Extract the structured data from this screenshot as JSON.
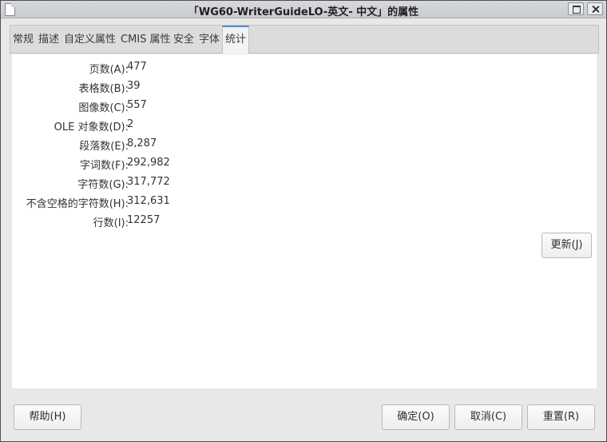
{
  "window": {
    "title": "「WG60-WriterGuideLO-英文- 中文」的属性"
  },
  "tabs": [
    {
      "label": "常规"
    },
    {
      "label": "描述"
    },
    {
      "label": "自定义属性"
    },
    {
      "label": "CMIS 属性"
    },
    {
      "label": "安全"
    },
    {
      "label": "字体"
    },
    {
      "label": "统计"
    }
  ],
  "active_tab": "统计",
  "statistics": [
    {
      "label": "页数(A):",
      "value": "477"
    },
    {
      "label": "表格数(B):",
      "value": "39"
    },
    {
      "label": "图像数(C):",
      "value": "557"
    },
    {
      "label": "OLE 对象数(D):",
      "value": "2"
    },
    {
      "label": "段落数(E):",
      "value": "8,287"
    },
    {
      "label": "字词数(F):",
      "value": "292,982"
    },
    {
      "label": "字符数(G):",
      "value": "317,772"
    },
    {
      "label": "不含空格的字符数(H):",
      "value": "312,631"
    },
    {
      "label": "行数(I):",
      "value": "12257"
    }
  ],
  "buttons": {
    "update": "更新(J)",
    "help": "帮助(H)",
    "ok": "确定(O)",
    "cancel": "取消(C)",
    "reset": "重置(R)"
  },
  "colors": {
    "accent": "#4a90d9"
  }
}
